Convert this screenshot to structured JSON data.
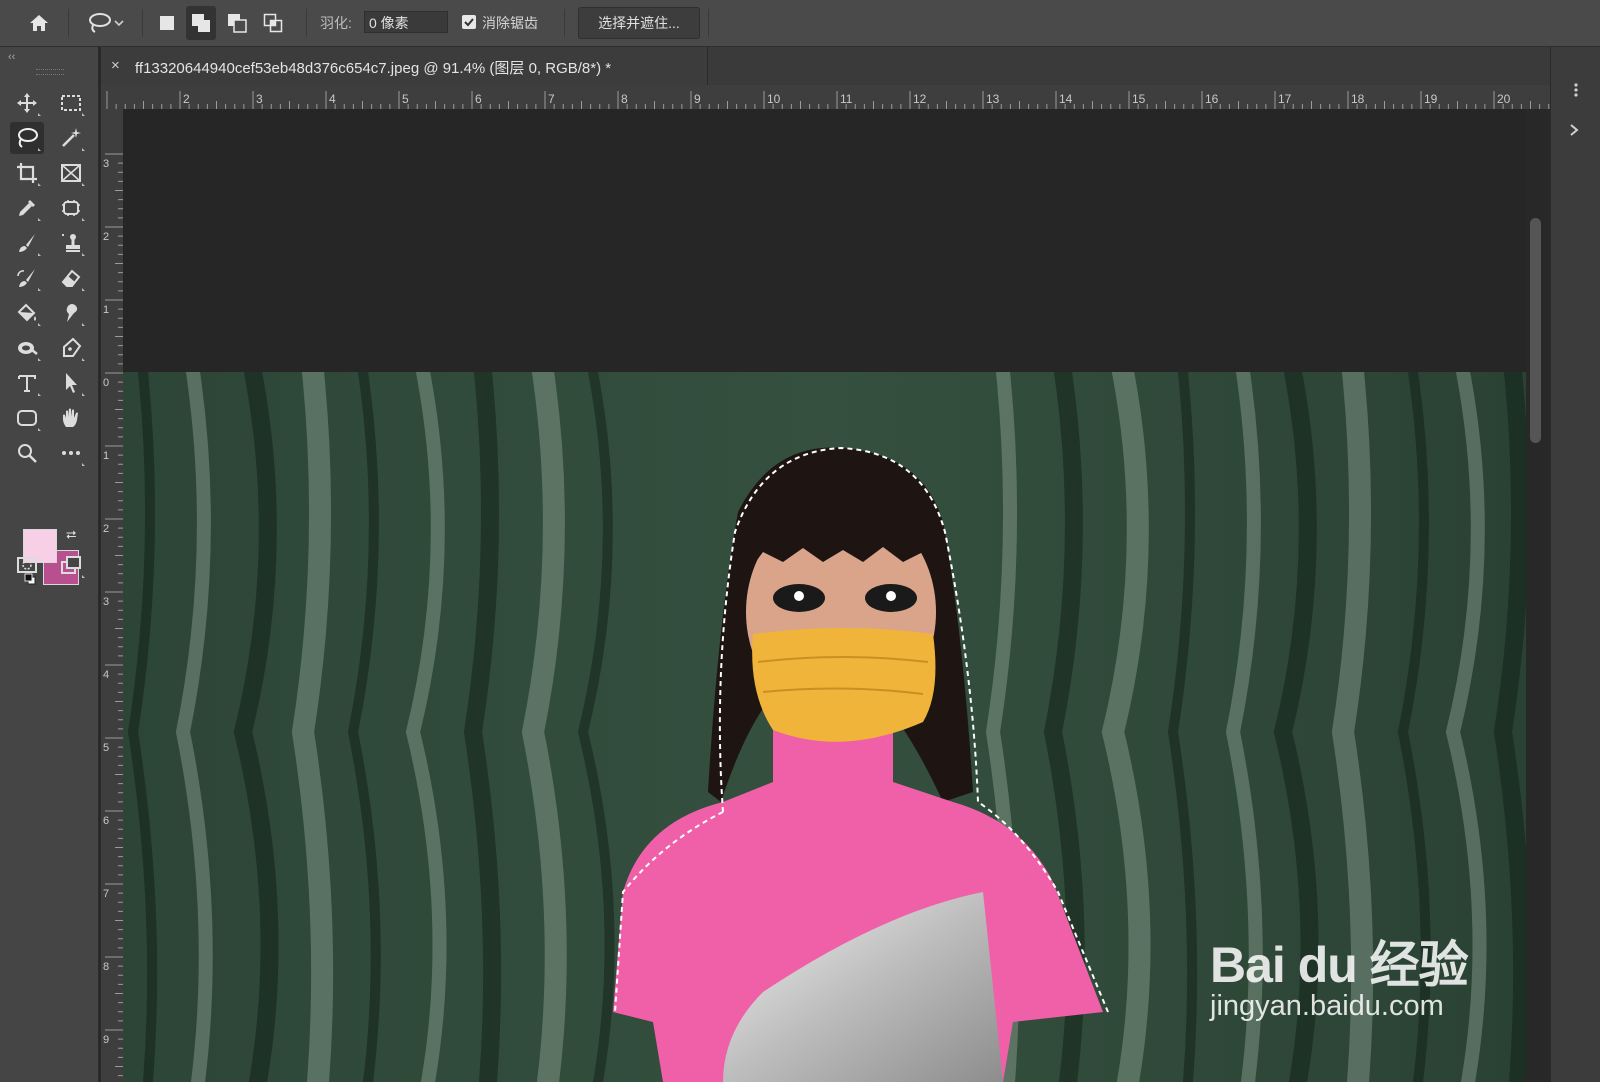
{
  "options_bar": {
    "feather_label": "羽化:",
    "feather_value": "0 像素",
    "antialias_label": "消除锯齿",
    "antialias_checked": true,
    "select_and_mask_label": "选择并遮住..."
  },
  "document": {
    "tab_title": "ff13320644940cef53eb48d376c654c7.jpeg @ 91.4% (图层 0, RGB/8*) *",
    "close_glyph": "×"
  },
  "rulers": {
    "horizontal_ticks": [
      "2",
      "3",
      "4",
      "5",
      "6",
      "7",
      "8",
      "9",
      "10",
      "11",
      "12",
      "13",
      "14",
      "15",
      "16",
      "17",
      "18",
      "19",
      "20"
    ],
    "vertical_ticks": [
      "3",
      "2",
      "1",
      "0",
      "1",
      "2",
      "3",
      "4",
      "5",
      "6",
      "7",
      "8",
      "9"
    ]
  },
  "toolbar": {
    "collapse_glyph": "‹‹",
    "tools": [
      {
        "name": "move-icon"
      },
      {
        "name": "marquee-icon"
      },
      {
        "name": "lasso-icon",
        "active": true
      },
      {
        "name": "magic-wand-icon"
      },
      {
        "name": "crop-icon"
      },
      {
        "name": "frame-icon"
      },
      {
        "name": "eyedropper-icon"
      },
      {
        "name": "spot-healing-icon"
      },
      {
        "name": "brush-icon"
      },
      {
        "name": "clone-stamp-icon"
      },
      {
        "name": "history-brush-icon"
      },
      {
        "name": "eraser-icon"
      },
      {
        "name": "paint-bucket-icon"
      },
      {
        "name": "smudge-icon"
      },
      {
        "name": "dodge-icon"
      },
      {
        "name": "pen-icon"
      },
      {
        "name": "type-icon"
      },
      {
        "name": "path-selection-icon"
      },
      {
        "name": "rectangle-icon"
      },
      {
        "name": "hand-icon"
      },
      {
        "name": "zoom-icon"
      },
      {
        "name": "more-tools-icon"
      }
    ],
    "foreground_color": "#f7cfe6",
    "background_color": "#b8508f"
  },
  "watermark": {
    "brand": "Bai du 经验",
    "url": "jingyan.baidu.com"
  },
  "colors": {
    "ui_panel": "#454545",
    "pasteboard": "#262626",
    "curtain_green": "#2f4a3b",
    "sweater_pink": "#f060a8",
    "mask_yellow": "#f0b43a"
  }
}
